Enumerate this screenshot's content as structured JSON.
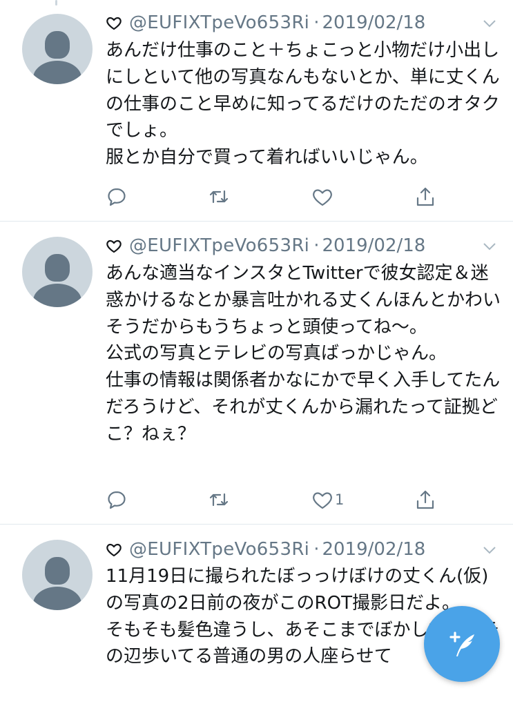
{
  "colors": {
    "accent": "#1da1f2",
    "fab": "#4aa3e8",
    "muted": "#657786",
    "text": "#14171a"
  },
  "tweets": [
    {
      "handle": "@EUFIXTpeVo653Ri",
      "separator": "·",
      "date": "2019/02/18",
      "text": "あんだけ仕事のこと＋ちょこっと小物だけ小出しにしといて他の写真なんもないとか、単に丈くんの仕事のこと早めに知ってるだけのただのオタクでしょ。\n服とか自分で買って着ればいいじゃん。",
      "like_count": ""
    },
    {
      "handle": "@EUFIXTpeVo653Ri",
      "separator": "·",
      "date": "2019/02/18",
      "text": "あんな適当なインスタとTwitterで彼女認定＆迷惑かけるなとか暴言吐かれる丈くんほんとかわいそうだからもうちょっと頭使ってね〜。\n公式の写真とテレビの写真ばっかじゃん。\n仕事の情報は関係者かなにかで早く入手してたんだろうけど、それが丈くんから漏れたって証拠どこ？ねぇ？",
      "like_count": "1"
    },
    {
      "handle": "@EUFIXTpeVo653Ri",
      "separator": "·",
      "date": "2019/02/18",
      "text": "11月19日に撮られたぼっっけぼけの丈くん(仮)の写真の2日前の夜がこのROT撮影日だよ。\nそもそも髪色違うし、あそこまでぼかしてたらその辺歩いてる普通の男の人座らせて",
      "like_count": ""
    }
  ],
  "icons": {
    "header": "heart-outline-icon",
    "menu": "chevron-down-icon",
    "reply": "reply-icon",
    "retweet": "retweet-icon",
    "like": "heart-icon",
    "share": "share-icon",
    "compose": "compose-tweet-icon"
  }
}
